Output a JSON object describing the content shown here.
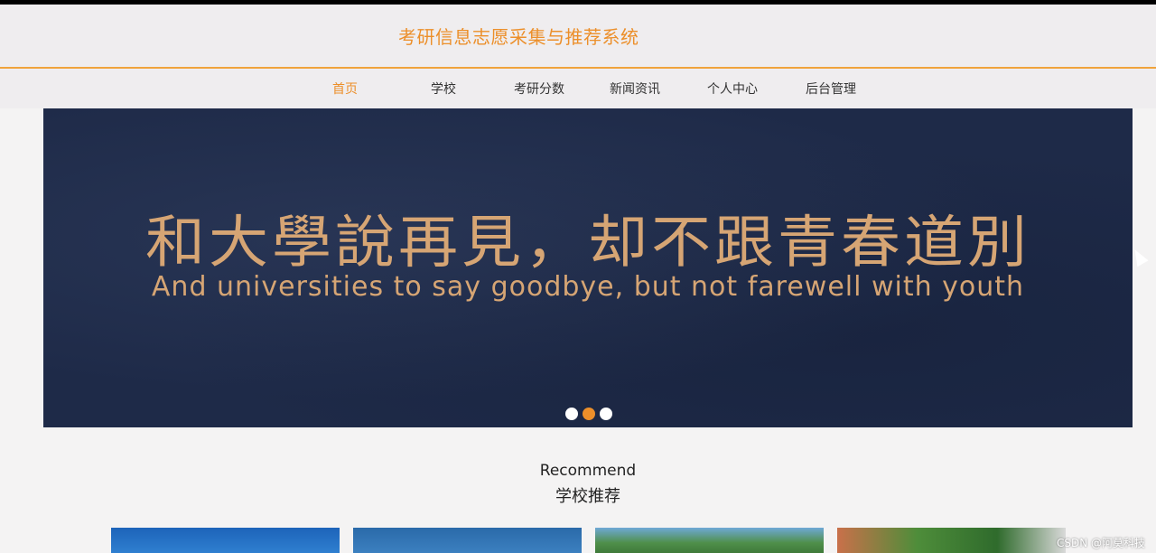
{
  "header": {
    "title": "考研信息志愿采集与推荐系统"
  },
  "nav": {
    "items": [
      "首页",
      "学校",
      "考研分数",
      "新闻资讯",
      "个人中心",
      "后台管理"
    ]
  },
  "banner": {
    "headline": "和大學說再見，却不跟青春道別",
    "subline": "And universities to say goodbye, but not farewell with youth",
    "active_dot": 1
  },
  "recommend": {
    "title_en": "Recommend",
    "title_cn": "学校推荐"
  },
  "watermark": "CSDN @阿莫科技",
  "colors": {
    "accent": "#ec8f2a",
    "banner_bg": "#1e2a48",
    "banner_text": "#d6a574"
  }
}
